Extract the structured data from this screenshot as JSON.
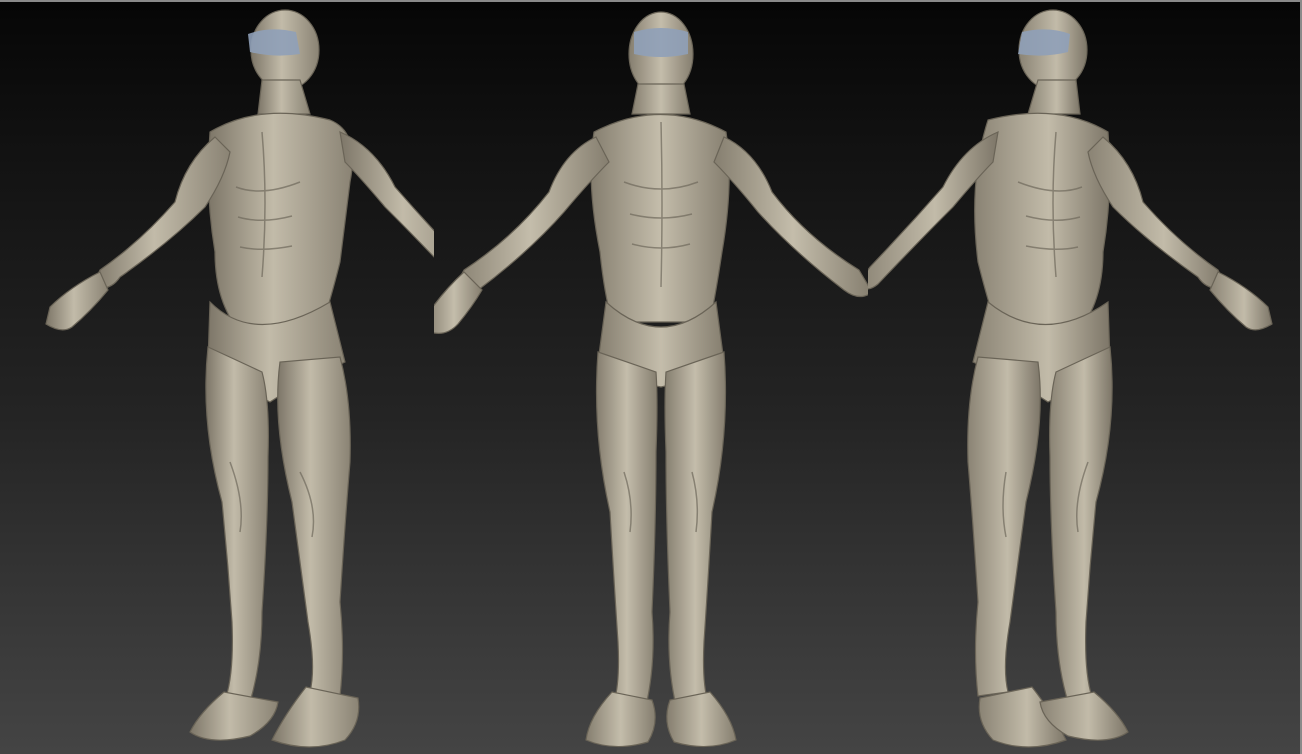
{
  "viewport": {
    "background_top": "#060606",
    "background_bottom": "#444444",
    "frame_color": "#8a8a8a"
  },
  "models": [
    {
      "id": "left-three-quarter-view",
      "material_color": "#b8b1a0",
      "eye_mask_color": "#8fa0b8"
    },
    {
      "id": "front-view",
      "material_color": "#b8b1a0",
      "eye_mask_color": "#8fa0b8"
    },
    {
      "id": "right-three-quarter-view",
      "material_color": "#b8b1a0",
      "eye_mask_color": "#8fa0b8"
    }
  ]
}
